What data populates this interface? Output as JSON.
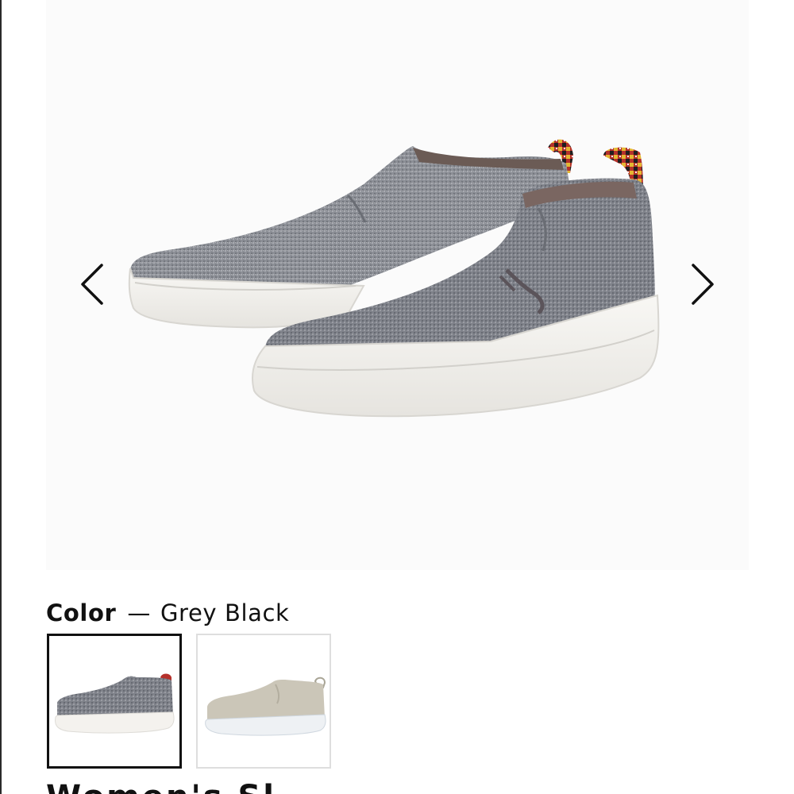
{
  "gallery": {
    "prev_icon": "chevron-left-icon",
    "next_icon": "chevron-right-icon"
  },
  "color_selector": {
    "label": "Color",
    "separator": "—",
    "selected_value": "Grey Black",
    "swatches": [
      {
        "name": "Grey Black",
        "selected": true
      },
      {
        "name": "Beige",
        "selected": false
      }
    ]
  },
  "product": {
    "title_partial": "Women's Sl"
  },
  "colors": {
    "text": "#111111",
    "swatch_selected_border": "#111111",
    "swatch_border": "#dedede",
    "shoe_grey": "#8e9097",
    "shoe_beige": "#cbc6b8",
    "sole_white": "#f4f2ee"
  }
}
